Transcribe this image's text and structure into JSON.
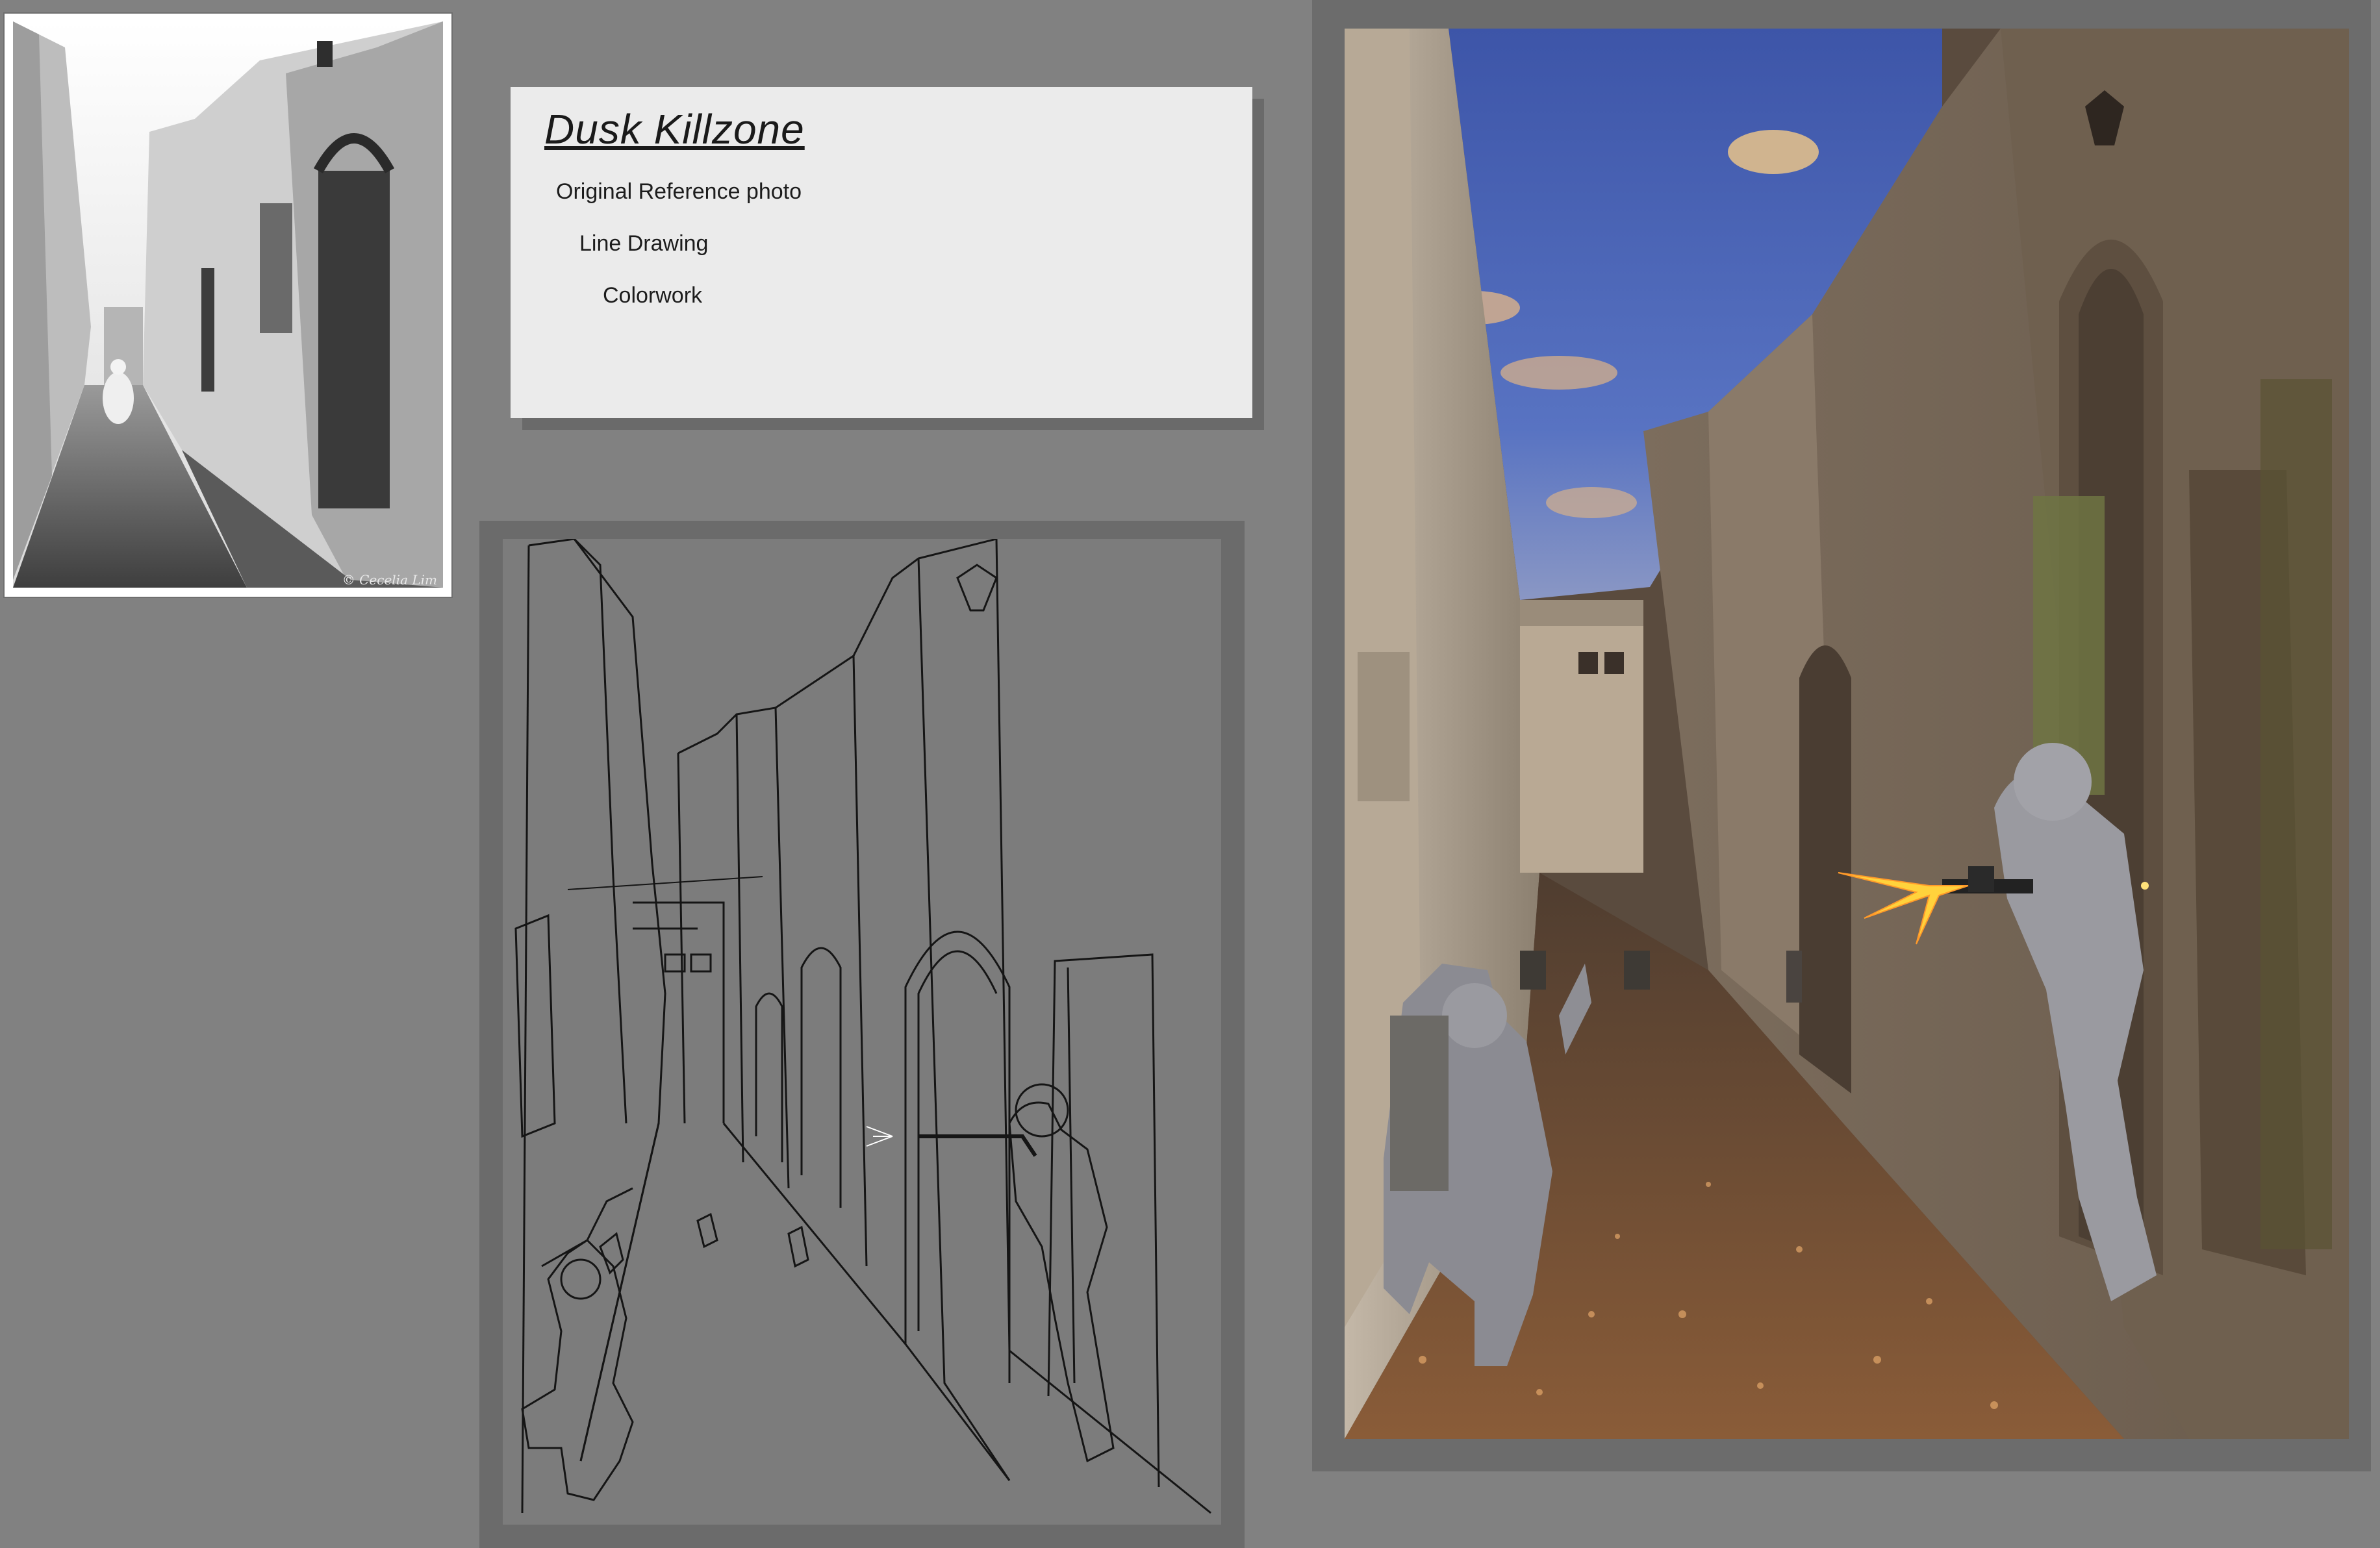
{
  "card": {
    "title": "Dusk Killzone",
    "items": [
      "Original Reference photo",
      "Line Drawing",
      "Colorwork"
    ]
  },
  "photo": {
    "credit": "© Cecelia Lim"
  },
  "colors": {
    "background": "#818181",
    "card": "#ebebeb",
    "sky": "#4a64b0",
    "ground": "#7a5536",
    "wall": "#8a7968",
    "muzzle_flash": "#ffd23c"
  }
}
